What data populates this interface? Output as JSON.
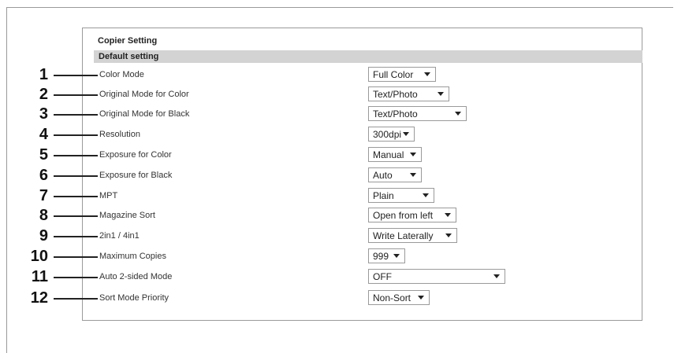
{
  "page": {
    "title": "Copier Setting",
    "section": "Default setting"
  },
  "rows": [
    {
      "num": "1",
      "label": "Color Mode",
      "value": "Full Color"
    },
    {
      "num": "2",
      "label": "Original Mode for Color",
      "value": "Text/Photo"
    },
    {
      "num": "3",
      "label": "Original Mode for Black",
      "value": "Text/Photo"
    },
    {
      "num": "4",
      "label": "Resolution",
      "value": "300dpi"
    },
    {
      "num": "5",
      "label": "Exposure for Color",
      "value": "Manual"
    },
    {
      "num": "6",
      "label": "Exposure for Black",
      "value": "Auto"
    },
    {
      "num": "7",
      "label": "MPT",
      "value": "Plain"
    },
    {
      "num": "8",
      "label": "Magazine Sort",
      "value": "Open from left"
    },
    {
      "num": "9",
      "label": "2in1 / 4in1",
      "value": "Write Laterally"
    },
    {
      "num": "10",
      "label": "Maximum Copies",
      "value": "999"
    },
    {
      "num": "11",
      "label": "Auto 2-sided Mode",
      "value": "OFF"
    },
    {
      "num": "12",
      "label": "Sort Mode Priority",
      "value": "Non-Sort"
    }
  ],
  "icons": {
    "dropdown": "chevron-down-icon"
  }
}
